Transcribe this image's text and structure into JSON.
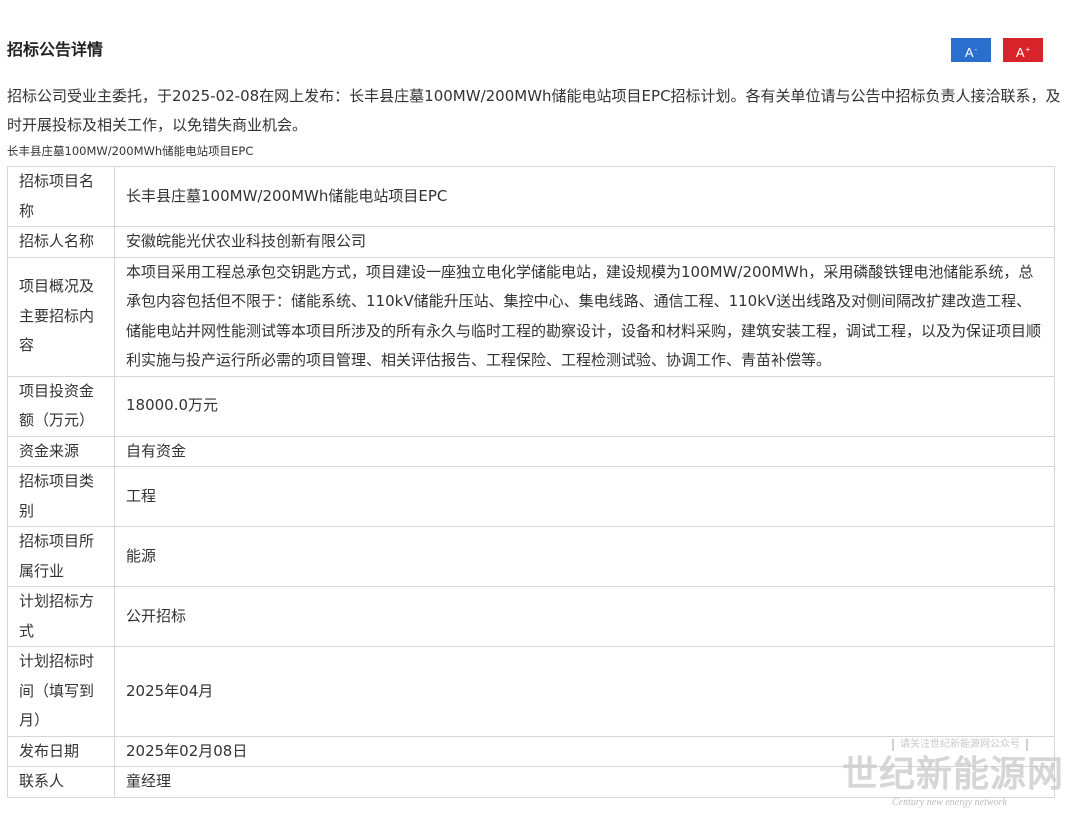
{
  "header": {
    "title": "招标公告详情",
    "font_smaller_label": "A",
    "font_smaller_sup": "-",
    "font_larger_label": "A",
    "font_larger_sup": "+"
  },
  "intro": "招标公司受业主委托，于2025-02-08在网上发布：长丰县庄墓100MW/200MWh储能电站项目EPC招标计划。各有关单位请与公告中招标负责人接洽联系，及时开展投标及相关工作，以免错失商业机会。",
  "subtitle": "长丰县庄墓100MW/200MWh储能电站项目EPC",
  "table": {
    "rows": [
      {
        "label": "招标项目名称",
        "value": "长丰县庄墓100MW/200MWh储能电站项目EPC"
      },
      {
        "label": "招标人名称",
        "value": "安徽皖能光伏农业科技创新有限公司"
      },
      {
        "label": "项目概况及主要招标内容",
        "value": "本项目采用工程总承包交钥匙方式，项目建设一座独立电化学储能电站，建设规模为100MW/200MWh，采用磷酸铁锂电池储能系统，总承包内容包括但不限于：储能系统、110kV储能升压站、集控中心、集电线路、通信工程、110kV送出线路及对侧间隔改扩建改造工程、储能电站并网性能测试等本项目所涉及的所有永久与临时工程的勘察设计，设备和材料采购，建筑安装工程，调试工程，以及为保证项目顺利实施与投产运行所必需的项目管理、相关评估报告、工程保险、工程检测试验、协调工作、青苗补偿等。"
      },
      {
        "label": "项目投资金额（万元）",
        "value": "18000.0万元"
      },
      {
        "label": "资金来源",
        "value": "自有资金"
      },
      {
        "label": "招标项目类别",
        "value": "工程"
      },
      {
        "label": "招标项目所属行业",
        "value": "能源"
      },
      {
        "label": "计划招标方式",
        "value": "公开招标"
      },
      {
        "label": "计划招标时间（填写到月）",
        "value": "2025年04月"
      },
      {
        "label": "发布日期",
        "value": "2025年02月08日"
      },
      {
        "label": "联系人",
        "value": "童经理"
      }
    ]
  },
  "watermark": {
    "top_text": "请关注世纪新能源网公众号",
    "main_text": "世纪新能源网",
    "sub_text": "Century new energy network"
  },
  "colors": {
    "btn_smaller": "#2a6fcf",
    "btn_larger": "#d8232a",
    "border": "#d6d6d6",
    "text": "#333333"
  }
}
